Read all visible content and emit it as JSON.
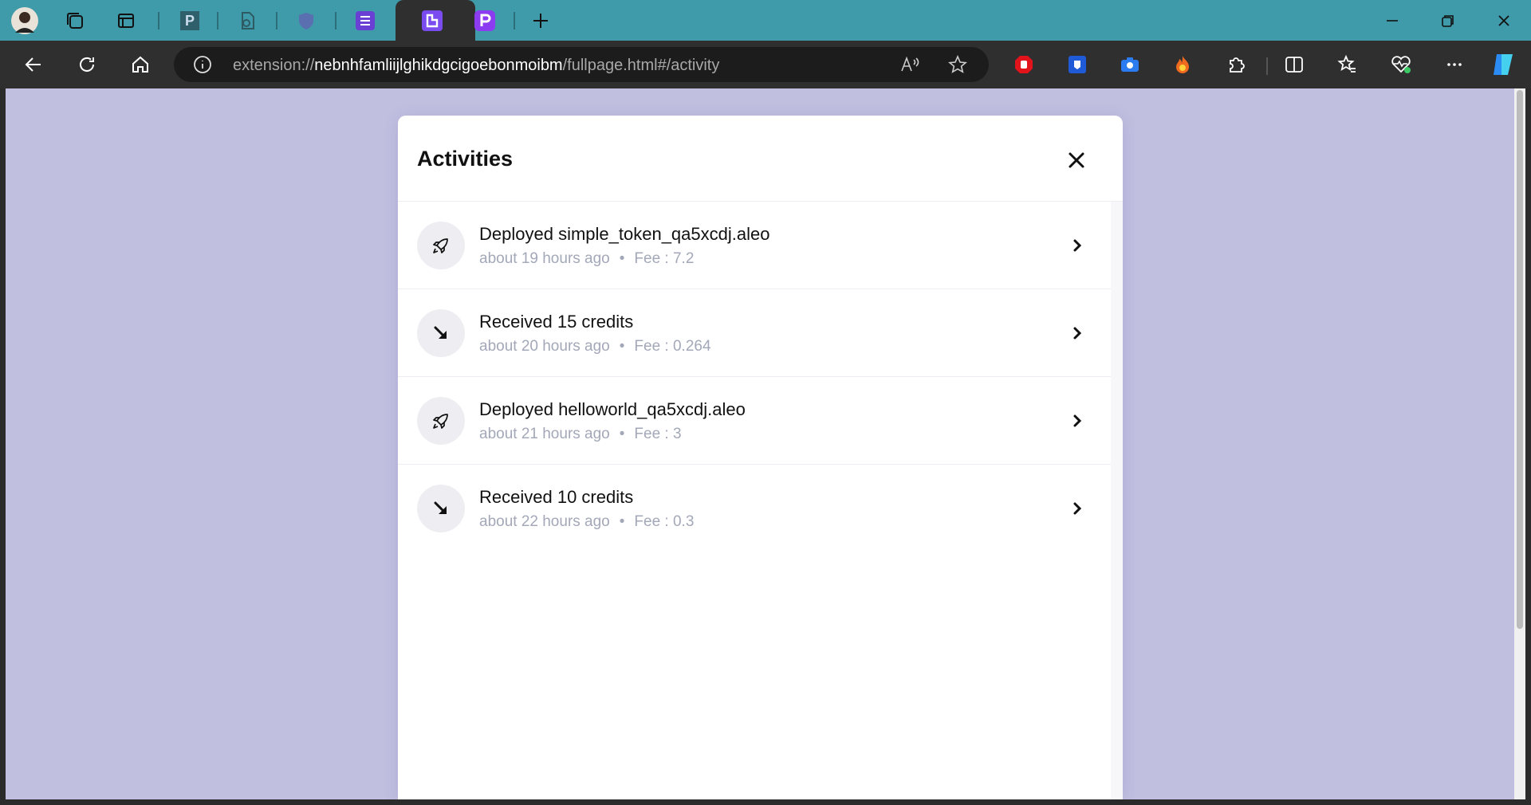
{
  "browser": {
    "url_scheme": "extension://",
    "url_host": "nebnhfamliijlghikdgcigoebonmoibm",
    "url_path": "/fullpage.html#/activity",
    "tab_letter_p": "P"
  },
  "modal": {
    "title": "Activities"
  },
  "activities": [
    {
      "title": "Deployed simple_token_qa5xcdj.aleo",
      "time": "about 19 hours ago",
      "fee": "Fee : 7.2",
      "icon": "rocket-icon"
    },
    {
      "title": "Received 15 credits",
      "time": "about 20 hours ago",
      "fee": "Fee : 0.264",
      "icon": "arrow-down-right-icon"
    },
    {
      "title": "Deployed helloworld_qa5xcdj.aleo",
      "time": "about 21 hours ago",
      "fee": "Fee : 3",
      "icon": "rocket-icon"
    },
    {
      "title": "Received 10 credits",
      "time": "about 22 hours ago",
      "fee": "Fee : 0.3",
      "icon": "arrow-down-right-icon"
    }
  ],
  "colors": {
    "tab_strip": "#3f9aa9",
    "toolbar": "#2f2f2f",
    "page_background": "#c0bfe0",
    "accent_purple": "#7a4cf0"
  }
}
